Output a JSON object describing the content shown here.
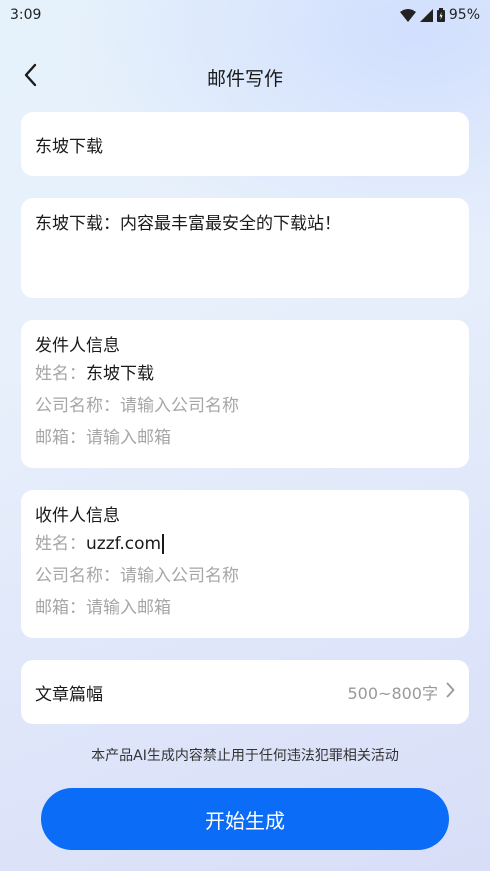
{
  "status_bar": {
    "time": "3:09",
    "battery": "95%"
  },
  "header": {
    "title": "邮件写作"
  },
  "subject": {
    "value": "东坡下载"
  },
  "body": {
    "value": "东坡下载：内容最丰富最安全的下载站！"
  },
  "sender": {
    "title": "发件人信息",
    "name_label": "姓名：",
    "name_value": "东坡下载",
    "company_label": "公司名称：",
    "company_placeholder": "请输入公司名称",
    "email_label": "邮箱：",
    "email_placeholder": "请输入邮箱"
  },
  "receiver": {
    "title": "收件人信息",
    "name_label": "姓名：",
    "name_value": "uzzf.com",
    "company_label": "公司名称：",
    "company_placeholder": "请输入公司名称",
    "email_label": "邮箱：",
    "email_placeholder": "请输入邮箱"
  },
  "length": {
    "label": "文章篇幅",
    "value": "500~800字"
  },
  "disclaimer": "本产品AI生成内容禁止用于任何违法犯罪相关活动",
  "start_button": "开始生成",
  "colors": {
    "accent": "#0a6cf7",
    "placeholder": "#a6a6a6"
  }
}
